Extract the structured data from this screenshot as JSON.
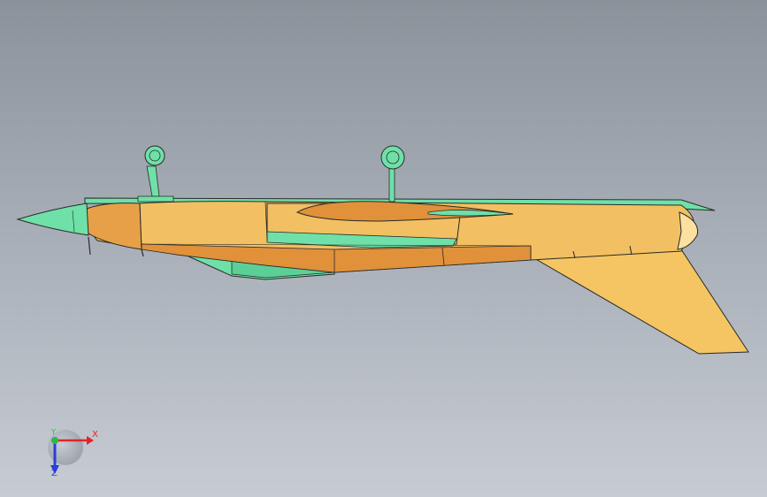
{
  "viewport": {
    "background_top": "#8b929a",
    "background_bottom": "#c7ccd3"
  },
  "model": {
    "body_color": "#f2c062",
    "shade_color": "#e0913a",
    "accent_color": "#6fe0a8",
    "edge_color": "#2a2a2a"
  },
  "triad": {
    "x_label": "X",
    "y_label": "Y",
    "z_label": "Z",
    "x_color": "#e0242a",
    "y_color": "#2fb84a",
    "z_color": "#2a3fd8"
  }
}
